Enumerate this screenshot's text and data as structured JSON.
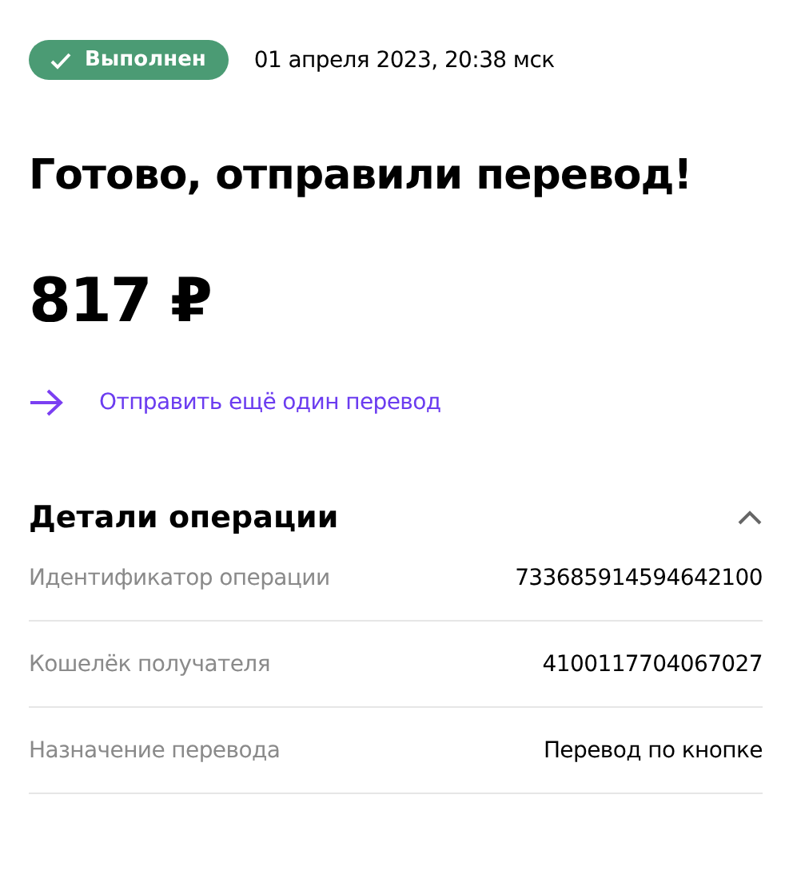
{
  "status": {
    "label": "Выполнен",
    "kind": "success"
  },
  "date": "01 апреля 2023, 20:38 мск",
  "title": "Готово, отправили перевод!",
  "amount": "817 ₽",
  "repeat_link": "Отправить ещё один перевод",
  "details": {
    "title": "Детали операции",
    "expanded": true,
    "rows": [
      {
        "label": "Идентификатор операции",
        "value": "733685914594642100"
      },
      {
        "label": "Кошелёк получателя",
        "value": "4100117704067027"
      },
      {
        "label": "Назначение перевода",
        "value": "Перевод по кнопке"
      }
    ]
  }
}
